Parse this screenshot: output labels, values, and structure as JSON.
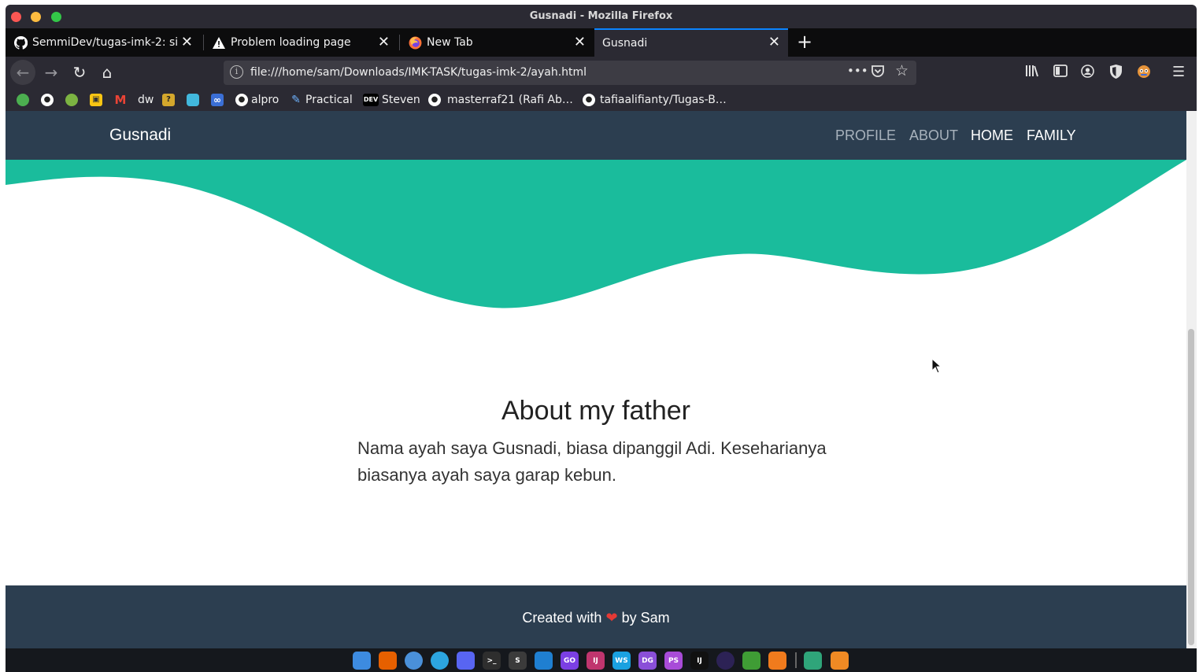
{
  "window": {
    "title": "Gusnadi - Mozilla Firefox"
  },
  "tabs": [
    {
      "label": "SemmiDev/tugas-imk-2: sin",
      "icon": "github-icon"
    },
    {
      "label": "Problem loading page",
      "icon": "warning-icon"
    },
    {
      "label": "New Tab",
      "icon": "firefox-icon"
    },
    {
      "label": "Gusnadi",
      "icon": "none",
      "active": true
    }
  ],
  "toolbar": {
    "url": "file:///home/sam/Downloads/IMK-TASK/tugas-imk-2/ayah.html",
    "page_actions": "•••"
  },
  "bookmarks": [
    {
      "label": "",
      "icon": "leaf-icon"
    },
    {
      "label": "",
      "icon": "github-icon"
    },
    {
      "label": "",
      "icon": "android-icon"
    },
    {
      "label": "",
      "icon": "image-icon"
    },
    {
      "label": "M",
      "icon": "gmail-icon"
    },
    {
      "label": "dw",
      "icon": "dw-icon"
    },
    {
      "label": "?",
      "icon": "question-icon"
    },
    {
      "label": "",
      "icon": "cube-icon"
    },
    {
      "label": "∞",
      "icon": "infinity-icon"
    },
    {
      "label": "alpro",
      "icon": "github-icon"
    },
    {
      "label": "Practical",
      "icon": "feather-icon"
    },
    {
      "label": "Steven",
      "icon": "dev-icon",
      "icon_text": "DEV"
    },
    {
      "label": "masterraf21 (Rafi Ab…",
      "icon": "github-icon"
    },
    {
      "label": "tafiaalifianty/Tugas-B…",
      "icon": "github-icon"
    }
  ],
  "site": {
    "brand": "Gusnadi",
    "menu": [
      "PROFILE",
      "ABOUT",
      "HOME",
      "FAMILY"
    ],
    "heading": "About my father",
    "paragraph": "Nama ayah saya Gusnadi, biasa dipanggil Adi. Keseharianya biasanya ayah saya garap kebun.",
    "footer_prefix": "Created with",
    "footer_heart": "❤",
    "footer_suffix": "by Sam",
    "colors": {
      "nav": "#2c3e50",
      "wave": "#1abc9c",
      "footer": "#2c3e50"
    }
  },
  "dock": [
    {
      "label": "",
      "icon": "finder-icon",
      "color": "#3d8be0"
    },
    {
      "label": "",
      "icon": "firefox-icon",
      "color": "#e66000"
    },
    {
      "label": "",
      "icon": "chromium-icon",
      "color": "#4a90d9"
    },
    {
      "label": "",
      "icon": "telegram-icon",
      "color": "#2ca5e0"
    },
    {
      "label": "",
      "icon": "discord-icon",
      "color": "#5865f2"
    },
    {
      "label": ">_",
      "icon": "terminal-icon",
      "color": "#2e2e2e"
    },
    {
      "label": "S",
      "icon": "sublime-icon",
      "color": "#3b3b3b"
    },
    {
      "label": "",
      "icon": "vscode-icon",
      "color": "#1f7fd1"
    },
    {
      "label": "GO",
      "icon": "goland-icon",
      "color": "#7b3fe4"
    },
    {
      "label": "IJ",
      "icon": "intellij-icon",
      "color": "#c0356e"
    },
    {
      "label": "WS",
      "icon": "webstorm-icon",
      "color": "#1aa1e0"
    },
    {
      "label": "DG",
      "icon": "datagrip-icon",
      "color": "#8a4fd8"
    },
    {
      "label": "PS",
      "icon": "phpstorm-icon",
      "color": "#a84bd8"
    },
    {
      "label": "IJ",
      "icon": "jetbrains-icon",
      "color": "#111111"
    },
    {
      "label": "",
      "icon": "eclipse-icon",
      "color": "#2c2255"
    },
    {
      "label": "",
      "icon": "mongodb-icon",
      "color": "#3f9c35"
    },
    {
      "label": "",
      "icon": "postman-icon",
      "color": "#f07b1d"
    },
    {
      "label": "",
      "icon": "files-icon",
      "color": "#2fa57a"
    },
    {
      "label": "",
      "icon": "store-icon",
      "color": "#f08a24"
    }
  ]
}
